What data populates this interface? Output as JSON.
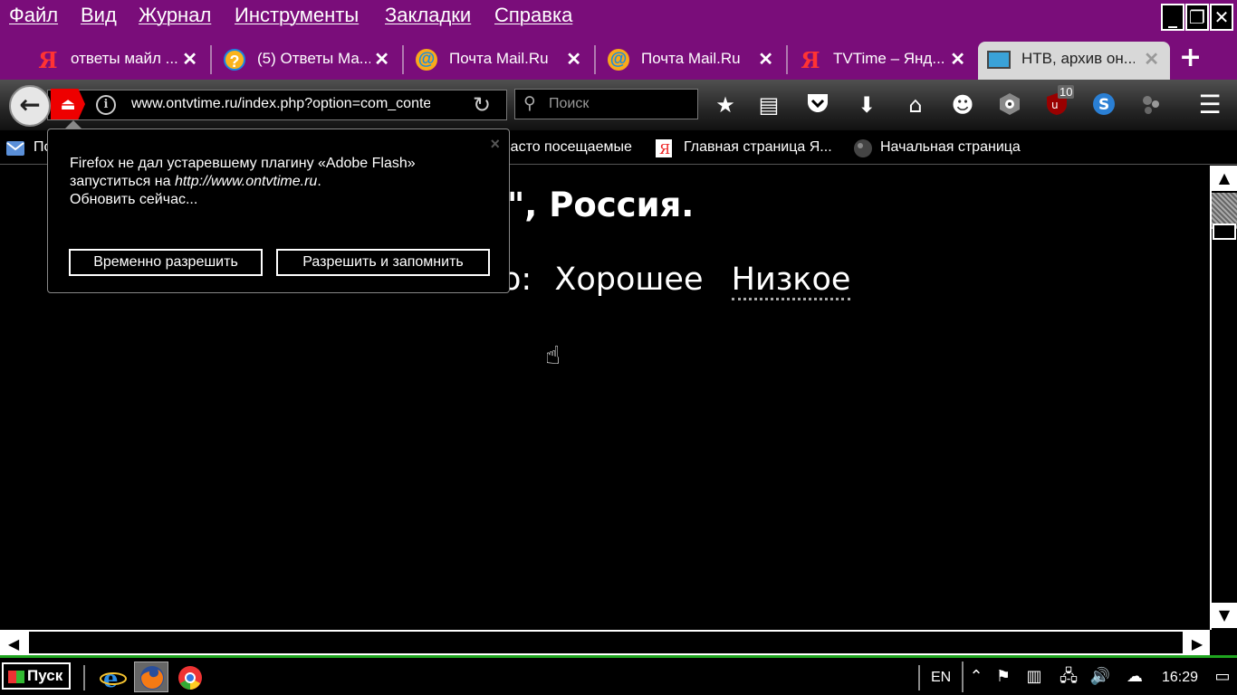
{
  "menubar": {
    "items": [
      "Файл",
      "Вид",
      "Журнал",
      "Инструменты",
      "Закладки",
      "Справка"
    ],
    "win_min": "_",
    "win_max": "❐",
    "win_close": "✕"
  },
  "tabs": [
    {
      "icon": "yandex-icon",
      "icon_text": "Я",
      "title": "ответы майл ..."
    },
    {
      "icon": "question-icon",
      "icon_text": "?",
      "title": "(5) Ответы Ма..."
    },
    {
      "icon": "mail-at-icon",
      "icon_text": "@",
      "title": "Почта Mail.Ru"
    },
    {
      "icon": "mail-at-icon",
      "icon_text": "@",
      "title": "Почта Mail.Ru"
    },
    {
      "icon": "yandex-icon",
      "icon_text": "Я",
      "title": "TVTime – Янд..."
    },
    {
      "icon": "monitor-icon",
      "icon_text": "",
      "title": "НТВ, архив он...",
      "active": true
    }
  ],
  "tab_close": "✕",
  "new_tab": "+",
  "navbar": {
    "back": "←",
    "info": "i",
    "url": "www.ontvtime.ru/index.php?option=com_content",
    "reload": "↻",
    "search_icon": "⚲",
    "search_placeholder": "Поиск",
    "badge": "10"
  },
  "bookmarks": [
    {
      "label": "По",
      "icon": "mail-icon"
    },
    {
      "label": "Часто посещаемые",
      "icon": "bookmark-folder-icon"
    },
    {
      "label": "Главная страница Я...",
      "icon": "yandex-icon"
    },
    {
      "label": "Начальная страница",
      "icon": "globe-icon"
    }
  ],
  "content": {
    "heading": "\", Россия.",
    "quality_prefix": "о:",
    "quality_good": "Хорошее",
    "quality_low": "Низкое"
  },
  "popup": {
    "line1": "Firefox не дал устаревшему плагину «Adobe Flash»",
    "line2_prefix": "запуститься на ",
    "line2_url": "http://www.ontvtime.ru",
    "line2_suffix": ".",
    "line3": "Обновить сейчас...",
    "close": "×",
    "btn_temp": "Временно разрешить",
    "btn_allow": "Разрешить и запомнить"
  },
  "taskbar": {
    "start": "Пуск",
    "lang": "EN",
    "clock": "16:29"
  },
  "colors": {
    "menubar_bg": "#7a0d7a",
    "taskbar_accent": "#1fa51f"
  }
}
